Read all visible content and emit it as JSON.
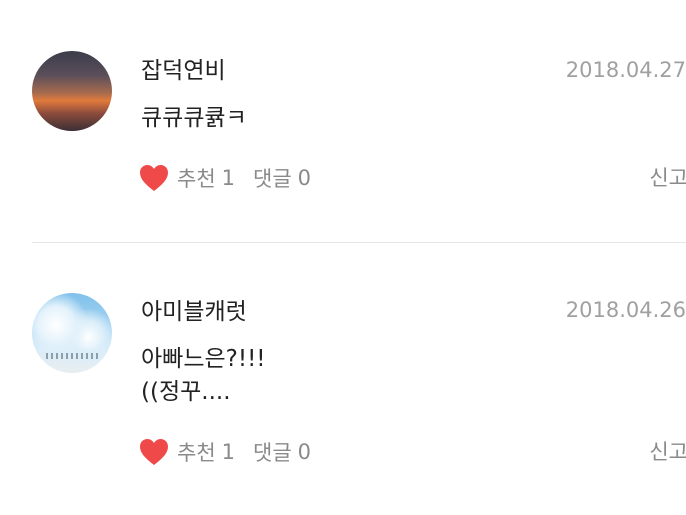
{
  "comments": [
    {
      "username": "잡덕연비",
      "date": "2018.04.27",
      "text": "큐큐큐큙ㅋ",
      "like_label": "추천",
      "like_count": "1",
      "reply_label": "댓글",
      "reply_count": "0",
      "report_label": "신고",
      "avatar_icon": "avatar-sunset",
      "heart_color": "#f0494a"
    },
    {
      "username": "아미블캐럿",
      "date": "2018.04.26",
      "text": "아빠느은?!!!\n((정꾸....",
      "like_label": "추천",
      "like_count": "1",
      "reply_label": "댓글",
      "reply_count": "0",
      "report_label": "신고",
      "avatar_icon": "avatar-sky",
      "heart_color": "#f0494a"
    }
  ]
}
